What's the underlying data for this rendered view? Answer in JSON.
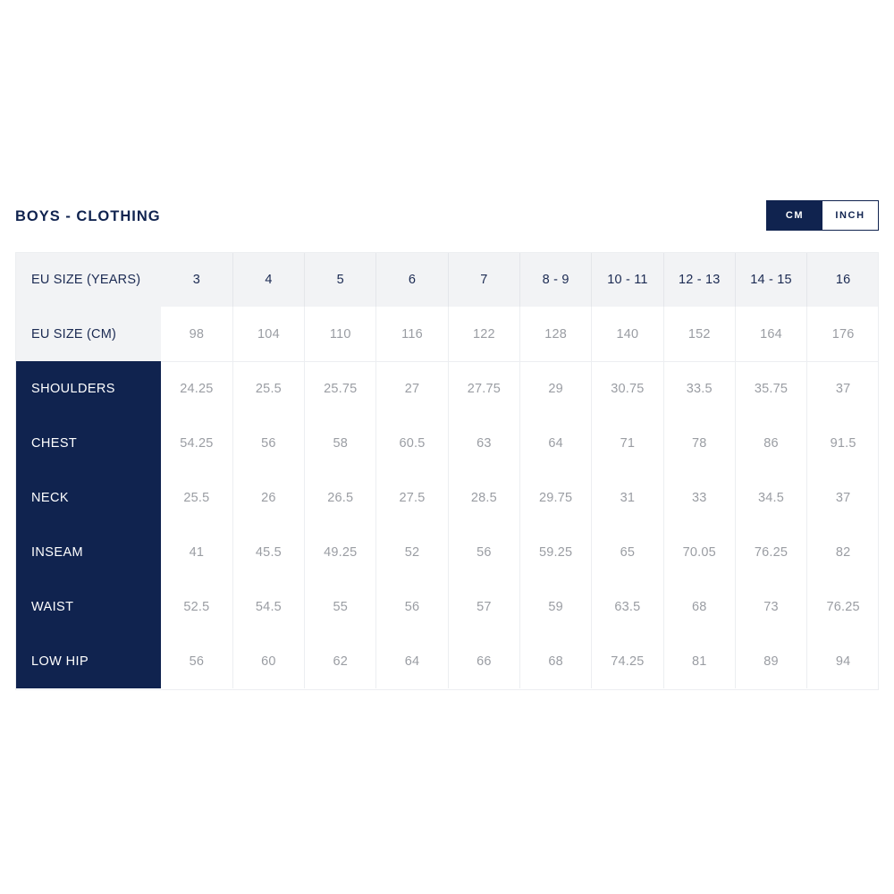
{
  "header": {
    "title": "BOYS - CLOTHING",
    "unit_toggle": {
      "active_unit": "CM",
      "options": [
        {
          "label": "CM",
          "active": true
        },
        {
          "label": "INCH",
          "active": false
        }
      ]
    }
  },
  "colors": {
    "navy": "#10234f",
    "header_gray": "#f2f3f5",
    "value_gray": "#9a9da3",
    "divider": "#eceef1",
    "background": "#ffffff"
  },
  "chart_data": {
    "type": "table",
    "title": "BOYS - CLOTHING",
    "unit": "CM",
    "row_headers": [
      "EU SIZE (YEARS)",
      "EU SIZE (CM)"
    ],
    "categories": [
      "3",
      "4",
      "5",
      "6",
      "7",
      "8 - 9",
      "10 - 11",
      "12 - 13",
      "14 - 15",
      "16"
    ],
    "eu_size_cm": [
      "98",
      "104",
      "110",
      "116",
      "122",
      "128",
      "140",
      "152",
      "164",
      "176"
    ],
    "measurement_labels": [
      "SHOULDERS",
      "CHEST",
      "NECK",
      "INSEAM",
      "WAIST",
      "LOW HIP"
    ],
    "series": [
      {
        "name": "SHOULDERS",
        "values": [
          "24.25",
          "25.5",
          "25.75",
          "27",
          "27.75",
          "29",
          "30.75",
          "33.5",
          "35.75",
          "37"
        ]
      },
      {
        "name": "CHEST",
        "values": [
          "54.25",
          "56",
          "58",
          "60.5",
          "63",
          "64",
          "71",
          "78",
          "86",
          "91.5"
        ]
      },
      {
        "name": "NECK",
        "values": [
          "25.5",
          "26",
          "26.5",
          "27.5",
          "28.5",
          "29.75",
          "31",
          "33",
          "34.5",
          "37"
        ]
      },
      {
        "name": "INSEAM",
        "values": [
          "41",
          "45.5",
          "49.25",
          "52",
          "56",
          "59.25",
          "65",
          "70.05",
          "76.25",
          "82"
        ]
      },
      {
        "name": "WAIST",
        "values": [
          "52.5",
          "54.5",
          "55",
          "56",
          "57",
          "59",
          "63.5",
          "68",
          "73",
          "76.25"
        ]
      },
      {
        "name": "LOW HIP",
        "values": [
          "56",
          "60",
          "62",
          "64",
          "66",
          "68",
          "74.25",
          "81",
          "89",
          "94"
        ]
      }
    ]
  }
}
